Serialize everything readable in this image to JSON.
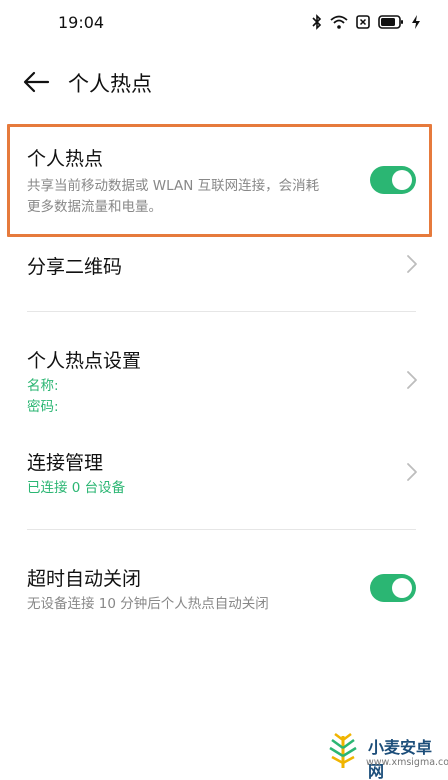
{
  "status_bar": {
    "time": "19:04",
    "icons": [
      "bluetooth-icon",
      "wifi-icon",
      "sim-icon",
      "battery-icon",
      "charging-icon"
    ]
  },
  "app_bar": {
    "back_icon": "arrow-left-icon",
    "title": "个人热点"
  },
  "hotspot": {
    "title": "个人热点",
    "description_line1": "共享当前移动数据或 WLAN 互联网连接，会消耗",
    "description_line2": "更多数据流量和电量。",
    "enabled": true
  },
  "share_qr": {
    "title": "分享二维码"
  },
  "hotspot_settings": {
    "title": "个人热点设置",
    "name_label": "名称:",
    "password_label": "密码:"
  },
  "connection_management": {
    "title": "连接管理",
    "subtitle": "已连接 0 台设备"
  },
  "auto_off": {
    "title": "超时自动关闭",
    "description": "无设备连接 10 分钟后个人热点自动关闭",
    "enabled": true
  },
  "colors": {
    "accent": "#2bb673",
    "highlight": "#e67a3c"
  },
  "watermark": {
    "title": "小麦安卓网",
    "url": "www.xmsigma.com"
  }
}
